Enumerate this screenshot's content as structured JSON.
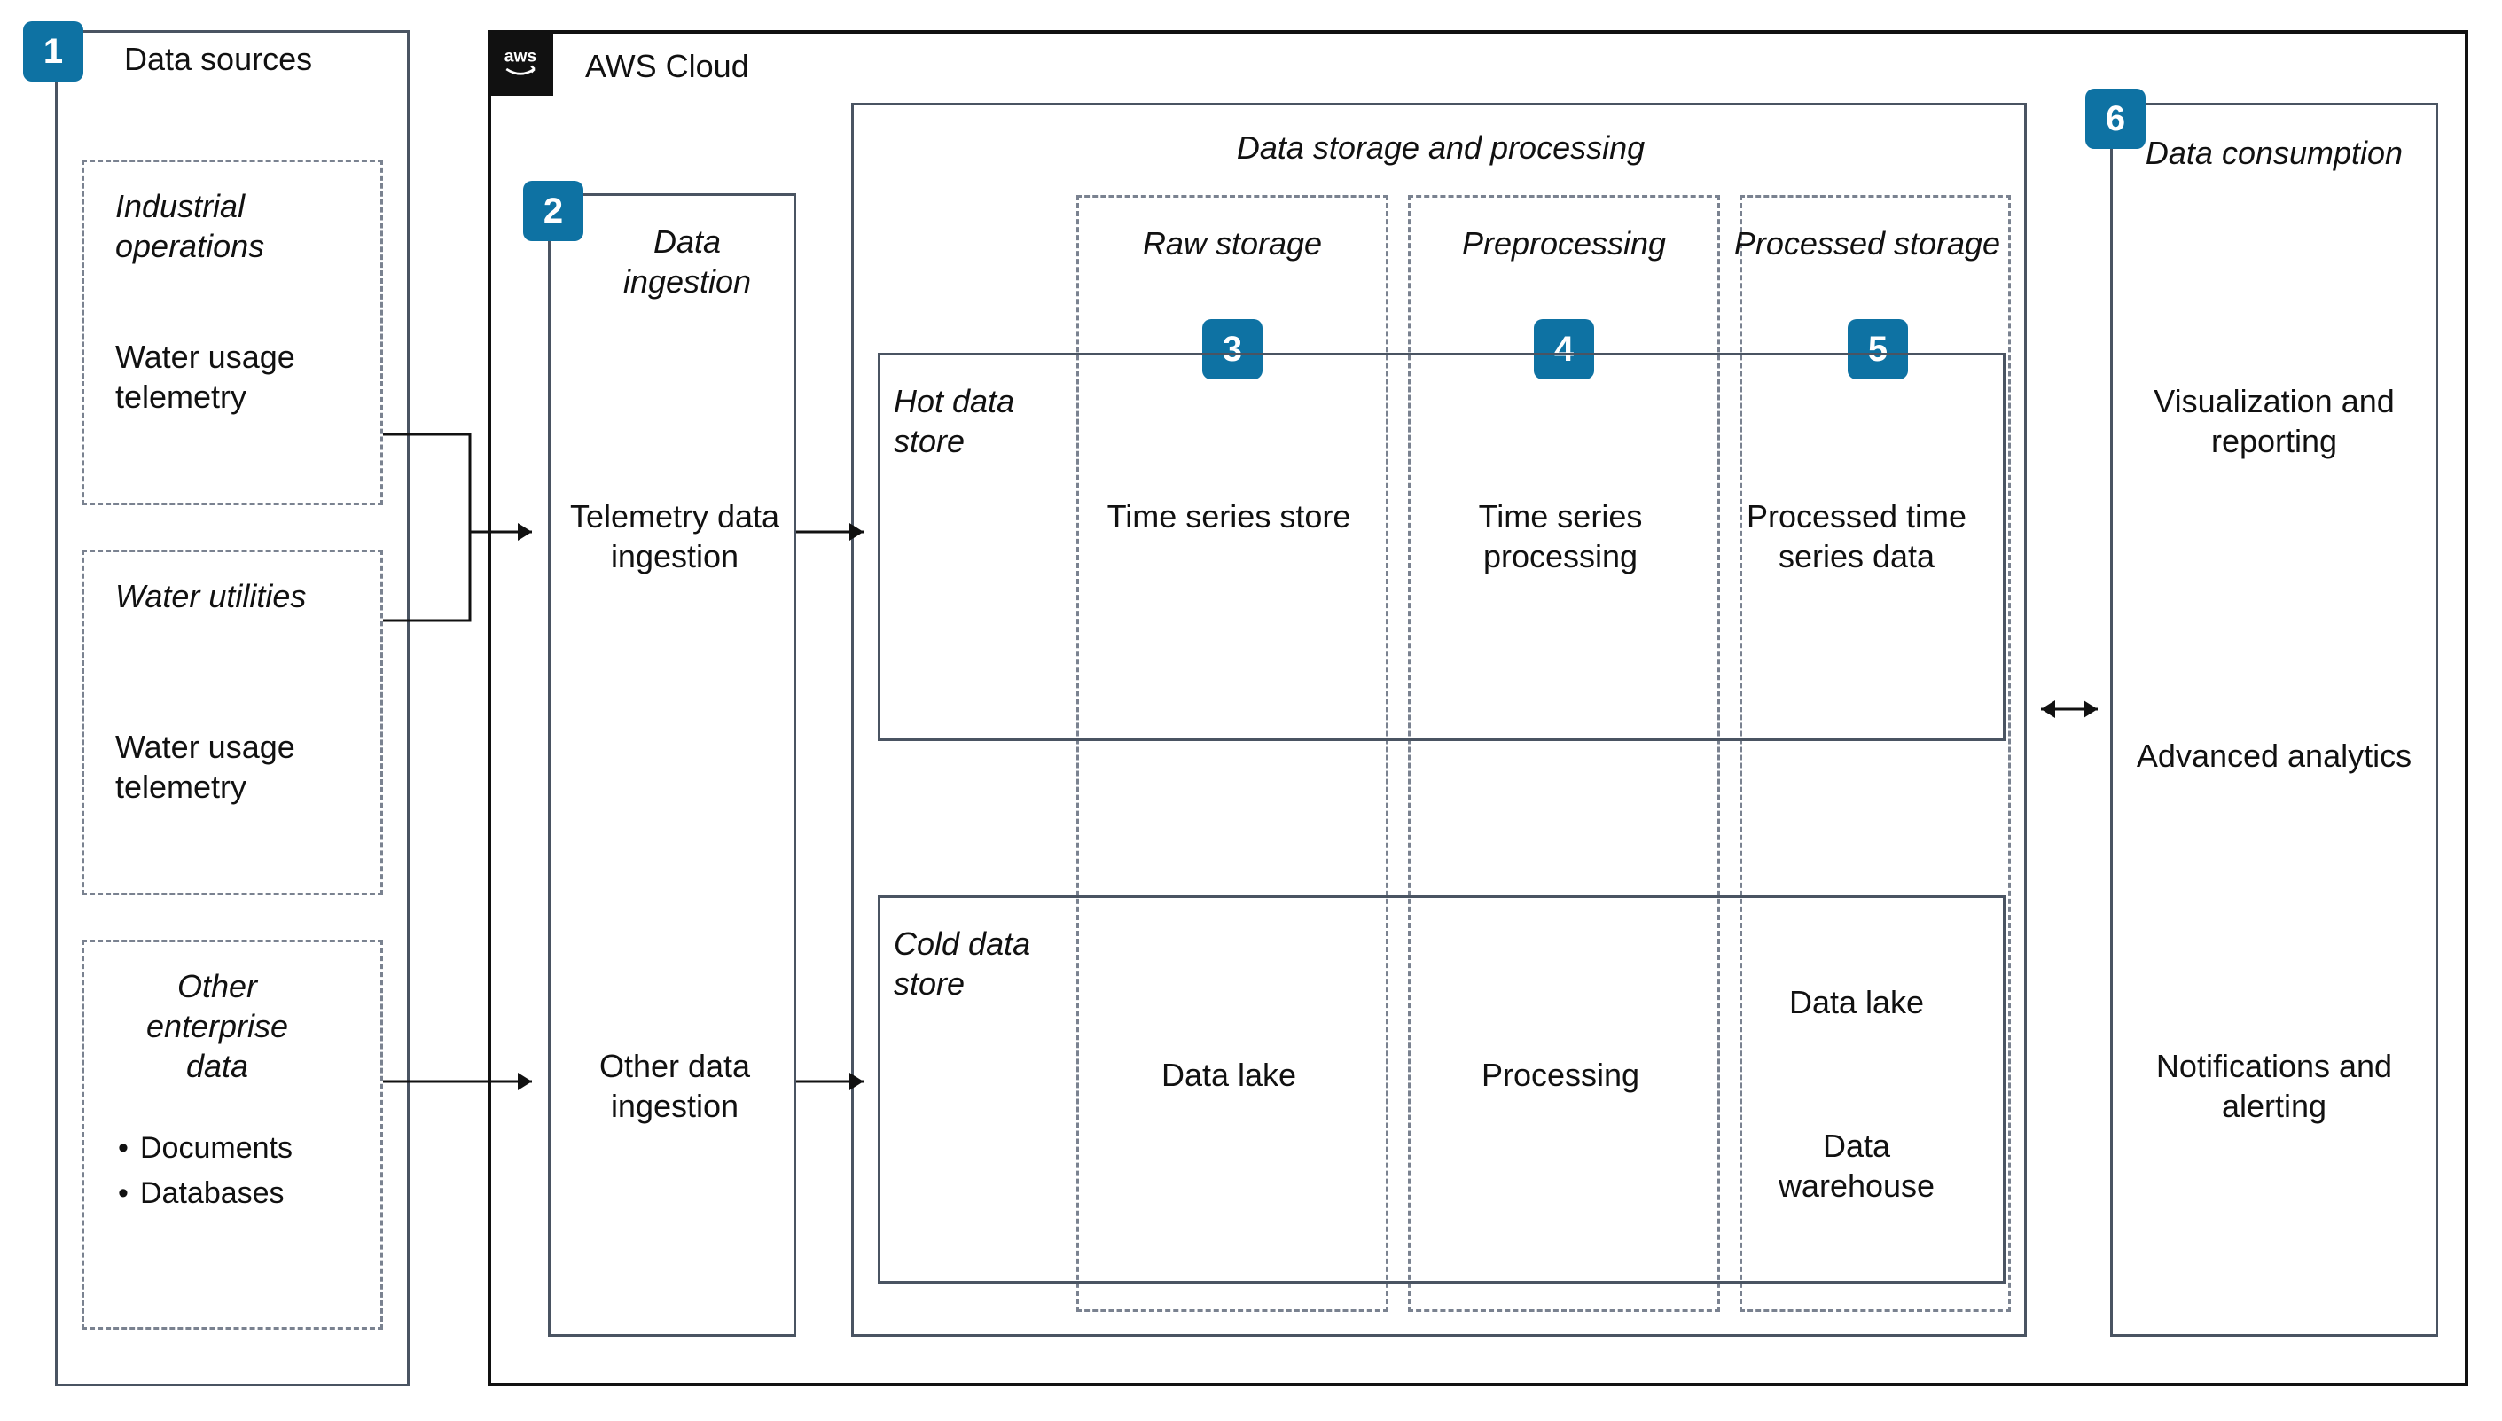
{
  "badges": {
    "one": "1",
    "two": "2",
    "three": "3",
    "four": "4",
    "five": "5",
    "six": "6"
  },
  "data_sources": {
    "title": "Data sources",
    "industrial": {
      "heading": "Industrial operations",
      "item": "Water usage telemetry"
    },
    "utilities": {
      "heading": "Water utilities",
      "item": "Water usage telemetry"
    },
    "enterprise": {
      "heading": "Other enterprise data",
      "bullets": [
        "Documents",
        "Databases"
      ]
    }
  },
  "cloud": {
    "title": "AWS Cloud",
    "logo_text": "aws"
  },
  "ingestion": {
    "title": "Data ingestion",
    "telemetry": "Telemetry data ingestion",
    "other": "Other data ingestion"
  },
  "storage": {
    "title": "Data storage and processing",
    "columns": {
      "raw": "Raw storage",
      "pre": "Preprocessing",
      "proc": "Processed storage"
    },
    "hot": {
      "title": "Hot data store",
      "raw": "Time series store",
      "pre": "Time series processing",
      "proc": "Processed time series data"
    },
    "cold": {
      "title": "Cold data store",
      "raw": "Data lake",
      "pre": "Processing",
      "proc_top": "Data lake",
      "proc_bottom": "Data warehouse"
    }
  },
  "consumption": {
    "title": "Data consumption",
    "viz": "Visualization and reporting",
    "analytics": "Advanced analytics",
    "alerting": "Notifications and alerting"
  }
}
